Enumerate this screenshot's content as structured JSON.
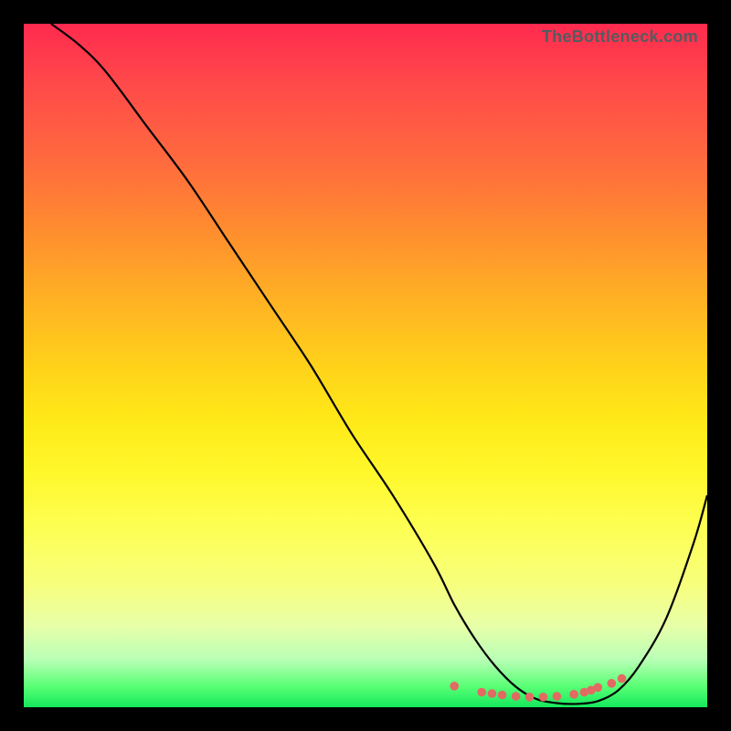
{
  "watermark": "TheBottleneck.com",
  "colors": {
    "frame": "#000000",
    "dot": "#e26a62",
    "curve": "#000000",
    "gradient_top": "#ff2a4f",
    "gradient_bottom": "#14e85d"
  },
  "chart_data": {
    "type": "line",
    "title": "",
    "xlabel": "",
    "ylabel": "",
    "xlim": [
      0,
      100
    ],
    "ylim": [
      0,
      100
    ],
    "grid": false,
    "legend": false,
    "series": [
      {
        "name": "bottleneck-curve",
        "x": [
          4,
          8,
          12,
          18,
          24,
          30,
          36,
          42,
          48,
          54,
          60,
          63,
          66,
          69,
          72,
          75,
          78,
          81,
          84,
          87,
          90,
          94,
          98,
          100
        ],
        "y": [
          100,
          97,
          93,
          85,
          77,
          68,
          59,
          50,
          40,
          31,
          21,
          15,
          10,
          6,
          3,
          1.2,
          0.6,
          0.5,
          0.9,
          2.5,
          6,
          13,
          24,
          31
        ]
      }
    ],
    "markers": {
      "name": "optimal-range-dots",
      "x": [
        63,
        67,
        68.5,
        70,
        72,
        74,
        76,
        78,
        80.5,
        82,
        83,
        84,
        86,
        87.5
      ],
      "y": [
        3.1,
        2.2,
        2.0,
        1.8,
        1.6,
        1.5,
        1.5,
        1.6,
        1.9,
        2.2,
        2.5,
        2.9,
        3.5,
        4.2
      ]
    }
  }
}
